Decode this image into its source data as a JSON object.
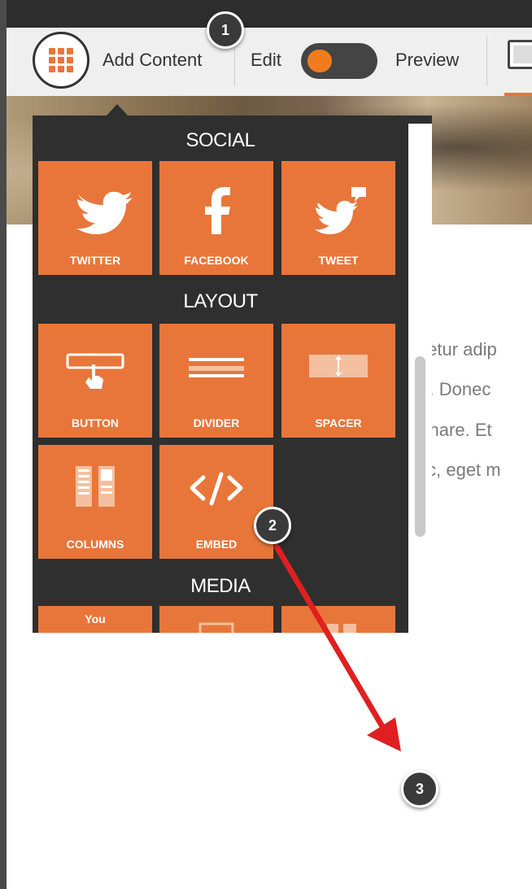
{
  "toolbar": {
    "add_content_label": "Add Content",
    "edit_label": "Edit",
    "preview_label": "Preview",
    "mode_toggle_state": "edit"
  },
  "panel": {
    "sections": [
      {
        "title": "SOCIAL",
        "items": [
          {
            "label": "TWITTER",
            "icon": "twitter-bird-icon"
          },
          {
            "label": "FACEBOOK",
            "icon": "facebook-f-icon"
          },
          {
            "label": "TWEET",
            "icon": "tweet-bird-icon"
          }
        ]
      },
      {
        "title": "LAYOUT",
        "items": [
          {
            "label": "BUTTON",
            "icon": "button-pointer-icon"
          },
          {
            "label": "DIVIDER",
            "icon": "divider-icon"
          },
          {
            "label": "SPACER",
            "icon": "spacer-icon"
          },
          {
            "label": "COLUMNS",
            "icon": "columns-icon"
          },
          {
            "label": "EMBED",
            "icon": "code-embed-icon"
          }
        ]
      },
      {
        "title": "MEDIA",
        "items": [
          {
            "label": "You",
            "icon": "youtube-icon"
          },
          {
            "label": "",
            "icon": "image-icon"
          },
          {
            "label": "",
            "icon": "gallery-icon"
          }
        ]
      }
    ]
  },
  "background_text": [
    "ctetur adip",
    "ra. Donec",
    "ornare. Et",
    "inc, eget m"
  ],
  "annotations": {
    "badges": [
      "1",
      "2",
      "3"
    ],
    "arrow_color": "#e02020"
  },
  "colors": {
    "accent": "#e8763a",
    "panel_bg": "#2f2f2f",
    "toggle_knob": "#f07c1e"
  }
}
